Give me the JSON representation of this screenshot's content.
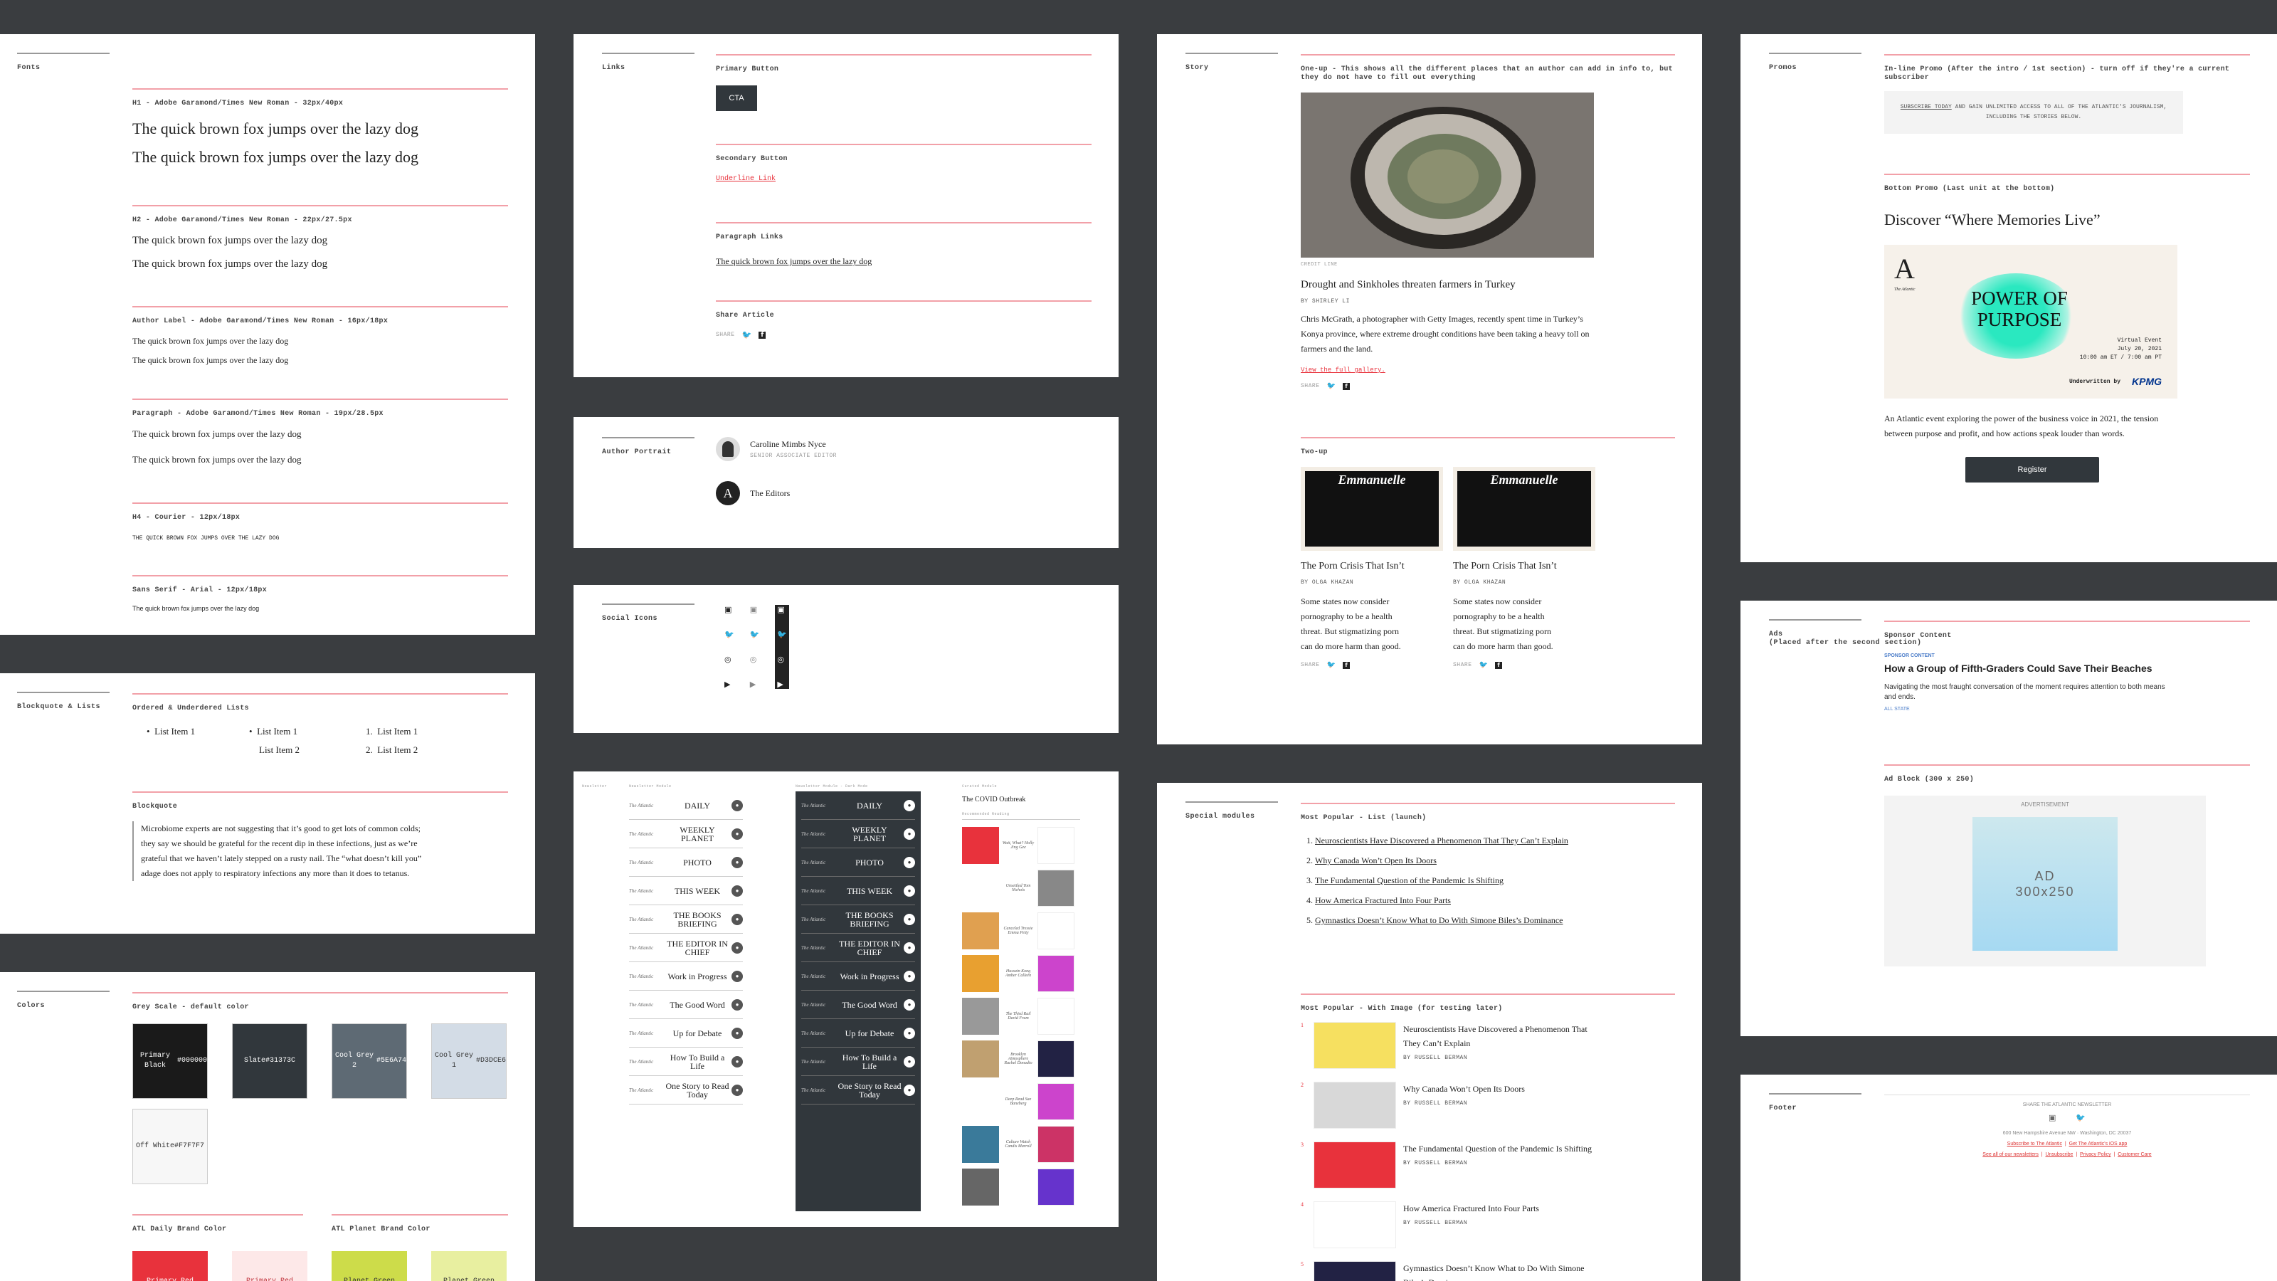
{
  "colors": {
    "background": "#3a3d40",
    "accent": "#e8323c",
    "divider": "#f2a0a8"
  },
  "fonts_panel": {
    "label": "Fonts",
    "sections": [
      {
        "heading": "H1 - Adobe Garamond/Times New Roman - 32px/40px",
        "lines": [
          "The quick brown fox jumps over the lazy dog",
          "The quick brown fox jumps over the lazy dog"
        ]
      },
      {
        "heading": "H2 - Adobe Garamond/Times New Roman - 22px/27.5px",
        "lines": [
          "The quick brown fox jumps over the lazy dog",
          "The quick brown fox jumps over the lazy dog"
        ]
      },
      {
        "heading": "Author Label  - Adobe Garamond/Times New Roman - 16px/18px",
        "lines": [
          "The quick brown fox jumps over the lazy dog",
          "The quick brown fox jumps over the lazy dog"
        ]
      },
      {
        "heading": "Paragraph - Adobe Garamond/Times New Roman - 19px/28.5px",
        "lines": [
          "The quick brown fox jumps over the lazy dog",
          "The quick brown fox jumps over the lazy dog"
        ]
      },
      {
        "heading": "H4 - Courier - 12px/18px",
        "lines": [
          "THE QUICK BROWN FOX JUMPS OVER THE LAZY DOG"
        ]
      },
      {
        "heading": "Sans Serif - Arial - 12px/18px",
        "lines": [
          "The quick brown fox jumps over the lazy dog"
        ]
      }
    ]
  },
  "blockquote_panel": {
    "label": "Blockquote & Lists",
    "lists_heading": "Ordered & Underdered Lists",
    "list_a": [
      "List Item 1"
    ],
    "list_b": [
      "List Item 1",
      "List Item 2"
    ],
    "list_c": [
      "List Item 1",
      "List Item 2"
    ],
    "blockquote_heading": "Blockquote",
    "blockquote_text": "Microbiome experts are not suggesting that it’s good to get lots of common colds; they say we should be grateful for the recent dip in these infections, just as we’re grateful that we haven’t lately stepped on a rusty nail. The “what doesn’t kill you” adage does not apply to respiratory infections any more than it does to tetanus."
  },
  "colors_panel": {
    "label": "Colors",
    "grey_heading": "Grey Scale - default color",
    "swatches": [
      {
        "name": "Primary Black",
        "hex": "#000000",
        "bg": "#1a1a1a",
        "fg": "#ffffff"
      },
      {
        "name": "Slate",
        "hex": "#31373C",
        "bg": "#31373c",
        "fg": "#ffffff"
      },
      {
        "name": "Cool Grey 2",
        "hex": "#5E6A74",
        "bg": "#5e6a74",
        "fg": "#ffffff"
      },
      {
        "name": "Cool Grey 1",
        "hex": "#D3DCE6",
        "bg": "#d3dce6",
        "fg": "#333333"
      },
      {
        "name": "Off White",
        "hex": "#F7F7F7",
        "bg": "#f7f7f7",
        "fg": "#333333"
      }
    ],
    "daily_heading": "ATL Daily Brand Color",
    "planet_heading": "ATL Planet Brand Color",
    "brand_swatches": [
      {
        "name": "Primary Red",
        "bg": "#e8323c",
        "fg": "#ffffff"
      },
      {
        "name": "Primary Red",
        "bg": "#fde8e8",
        "fg": "#c0303a"
      },
      {
        "name": "Planet Green",
        "bg": "#cddc4a",
        "fg": "#333333"
      },
      {
        "name": "Planet Green",
        "bg": "#e8efa0",
        "fg": "#333333"
      }
    ]
  },
  "links_panel": {
    "label": "Links",
    "primary_heading": "Primary Button",
    "primary_cta": "CTA",
    "secondary_heading": "Secondary Button",
    "secondary_link": "Underline Link",
    "paragraph_heading": "Paragraph Links",
    "paragraph_link": "The quick brown fox jumps over the lazy dog",
    "share_heading": "Share Article",
    "share_label": "SHARE"
  },
  "author_panel": {
    "label": "Author Portrait",
    "authors": [
      {
        "name": "Caroline Mimbs Nyce",
        "role": "SENIOR ASSOCIATE EDITOR"
      },
      {
        "name": "The Editors",
        "role": ""
      }
    ],
    "editors_monogram": "A"
  },
  "social_panel": {
    "label": "Social Icons"
  },
  "newsletter_panel": {
    "label": "Newsletter",
    "col1_label": "Newsletter Module",
    "col2_label": "Newsletter Module - Dark Mode",
    "col3_label": "Curated Module",
    "brand": "The Atlantic",
    "names": [
      "DAILY",
      "WEEKLY PLANET",
      "PHOTO",
      "THIS WEEK",
      "THE BOOKS BRIEFING",
      "THE EDITOR IN CHIEF",
      "Work in Progress",
      "The Good Word",
      "Up for Debate",
      "How To Build a Life",
      "One Story to Read Today"
    ],
    "curated_title": "The COVID Outbreak",
    "curated_subtitle": "Recommended Reading",
    "curated_items": [
      "Wait, What? Holly Jing Gee",
      "Unsettled Tom Nichols",
      "Canceled Tressie Emma Petty",
      "Hussain Kong Amber Calleen",
      "The Third Rail David Frum",
      "Brooklyn Atmosphere Rachel Donadio",
      "Deep Read Sae Baneberg",
      "Culture Watch Candis Marroll"
    ]
  },
  "story_panel": {
    "label": "Story",
    "oneup_heading": "One-up - This shows all the different places that an author can add in info to, but they do not have to fill out everything",
    "credit": "CREDIT LINE",
    "title": "Drought and Sinkholes threaten farmers in Turkey",
    "byline": "BY SHIRLEY LI",
    "body": "Chris McGrath, a photographer with Getty Images, recently spent time in Turkey’s Konya province, where extreme drought conditions have been taking a heavy toll on farmers and the land.",
    "link": "View the full gallery.",
    "share_label": "SHARE",
    "twoup_heading": "Two-up",
    "twoup_items": [
      {
        "image_text": "Emmanuelle",
        "title": "The Porn Crisis That Isn’t",
        "byline": "BY OLGA KHAZAN",
        "body": "Some states now consider pornography to be a health threat. But stigmatizing porn can do more harm than good."
      },
      {
        "image_text": "Emmanuelle",
        "title": "The Porn Crisis That Isn’t",
        "byline": "BY OLGA KHAZAN",
        "body": "Some states now consider pornography to be a health threat. But stigmatizing porn can do more harm than good."
      }
    ]
  },
  "special_panel": {
    "label": "Special modules",
    "list_heading": "Most Popular - List (launch)",
    "list_items": [
      "Neuroscientists Have Discovered a Phenomenon That They Can’t Explain",
      "Why Canada Won’t Open Its Doors",
      "The Fundamental Question of the Pandemic Is Shifting",
      "How America Fractured Into Four Parts",
      "Gymnastics Doesn’t Know What to Do With Simone Biles’s Dominance"
    ],
    "image_heading": "Most Popular - With Image (for testing later)",
    "image_items": [
      {
        "n": "1",
        "title": "Neuroscientists Have Discovered a Phenomenon That They Can’t Explain",
        "byline": "BY RUSSELL BERMAN"
      },
      {
        "n": "2",
        "title": "Why Canada Won’t Open Its Doors",
        "byline": "BY RUSSELL BERMAN"
      },
      {
        "n": "3",
        "title": "The Fundamental Question of the Pandemic Is Shifting",
        "byline": "BY RUSSELL BERMAN"
      },
      {
        "n": "4",
        "title": "How America Fractured Into Four Parts",
        "byline": "BY RUSSELL BERMAN"
      },
      {
        "n": "5",
        "title": "Gymnastics Doesn’t Know What to Do With Simone Biles’s Dominance",
        "byline": ""
      }
    ]
  },
  "promos_panel": {
    "label": "Promos",
    "inline_heading": "In-line Promo (After the intro / 1st section) - turn off if they're a current subscriber",
    "inline_link": "SUBSCRIBE TODAY",
    "inline_text": "AND GAIN UNLIMITED ACCESS TO ALL OF THE ATLANTIC'S JOURNALISM, INCLUDING THE STORIES BELOW.",
    "bottom_heading": "Bottom Promo (Last unit at the bottom)",
    "promo_title": "Discover “Where Memories Live”",
    "event_logo": "A",
    "event_logo_sub": "The Atlantic",
    "event_name": "POWER OF PURPOSE",
    "event_type": "Virtual Event",
    "event_date": "July 20, 2021",
    "event_time": "10:00 am ET / 7:00 am PT",
    "underwritten": "Underwritten by",
    "sponsor": "KPMG",
    "promo_body": "An Atlantic event exploring the power of the business voice in 2021, the tension between purpose and profit, and how actions speak louder than words.",
    "register": "Register"
  },
  "ads_panel": {
    "label": "Ads\n(Placed after the second section)",
    "sponsor_heading": "Sponsor Content",
    "sponsor_tag": "SPONSOR CONTENT",
    "sponsor_title": "How a Group of Fifth-Graders Could Save Their Beaches",
    "sponsor_body": "Navigating the most fraught conversation of the moment requires attention to both means and ends.",
    "sponsor_by": "ALL STATE",
    "ad_heading": "Ad Block (300 x 250)",
    "ad_label": "ADVERTISEMENT",
    "ad_text": "AD\n300x250"
  },
  "footer_panel": {
    "label": "Footer",
    "share_line": "SHARE THE ATLANTIC NEWSLETTER",
    "address": "600 New Hampshire Avenue NW · Washington, DC 20037",
    "links1": [
      "Subscribe to The Atlantic",
      "Get The Atlantic's iOS app"
    ],
    "links2": [
      "See all of our newsletters",
      "Unsubscribe",
      "Privacy Policy",
      "Customer Care"
    ]
  }
}
